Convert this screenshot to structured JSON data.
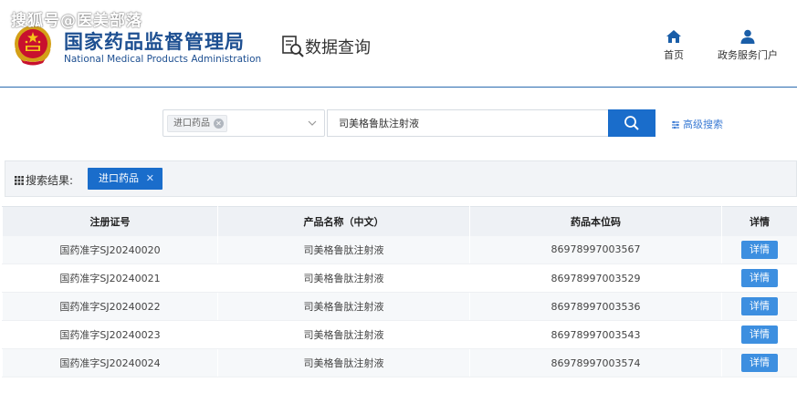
{
  "watermark": "搜狐号@医美部落",
  "header": {
    "org_name_cn": "国家药品监督管理局",
    "org_name_en": "National Medical Products Administration",
    "section_title": "数据查询",
    "nav": [
      {
        "label": "首页",
        "icon": "home-icon"
      },
      {
        "label": "政务服务门户",
        "icon": "user-icon"
      }
    ]
  },
  "search": {
    "category_tag": "进口药品",
    "keyword_value": "司美格鲁肽注射液",
    "advanced_label": "高级搜索"
  },
  "results": {
    "label": "搜索结果:",
    "active_tag": "进口药品"
  },
  "table": {
    "headers": [
      "注册证号",
      "产品名称（中文）",
      "药品本位码",
      "详情"
    ],
    "detail_label": "详情",
    "rows": [
      {
        "reg_no": "国药准字SJ20240020",
        "name": "司美格鲁肽注射液",
        "code": "86978997003567"
      },
      {
        "reg_no": "国药准字SJ20240021",
        "name": "司美格鲁肽注射液",
        "code": "86978997003529"
      },
      {
        "reg_no": "国药准字SJ20240022",
        "name": "司美格鲁肽注射液",
        "code": "86978997003536"
      },
      {
        "reg_no": "国药准字SJ20240023",
        "name": "司美格鲁肽注射液",
        "code": "86978997003543"
      },
      {
        "reg_no": "国药准字SJ20240024",
        "name": "司美格鲁肽注射液",
        "code": "86978997003574"
      }
    ]
  },
  "colors": {
    "brand_blue": "#1d4f91",
    "button_blue": "#1a6dcb",
    "detail_blue": "#3d8fe0"
  }
}
